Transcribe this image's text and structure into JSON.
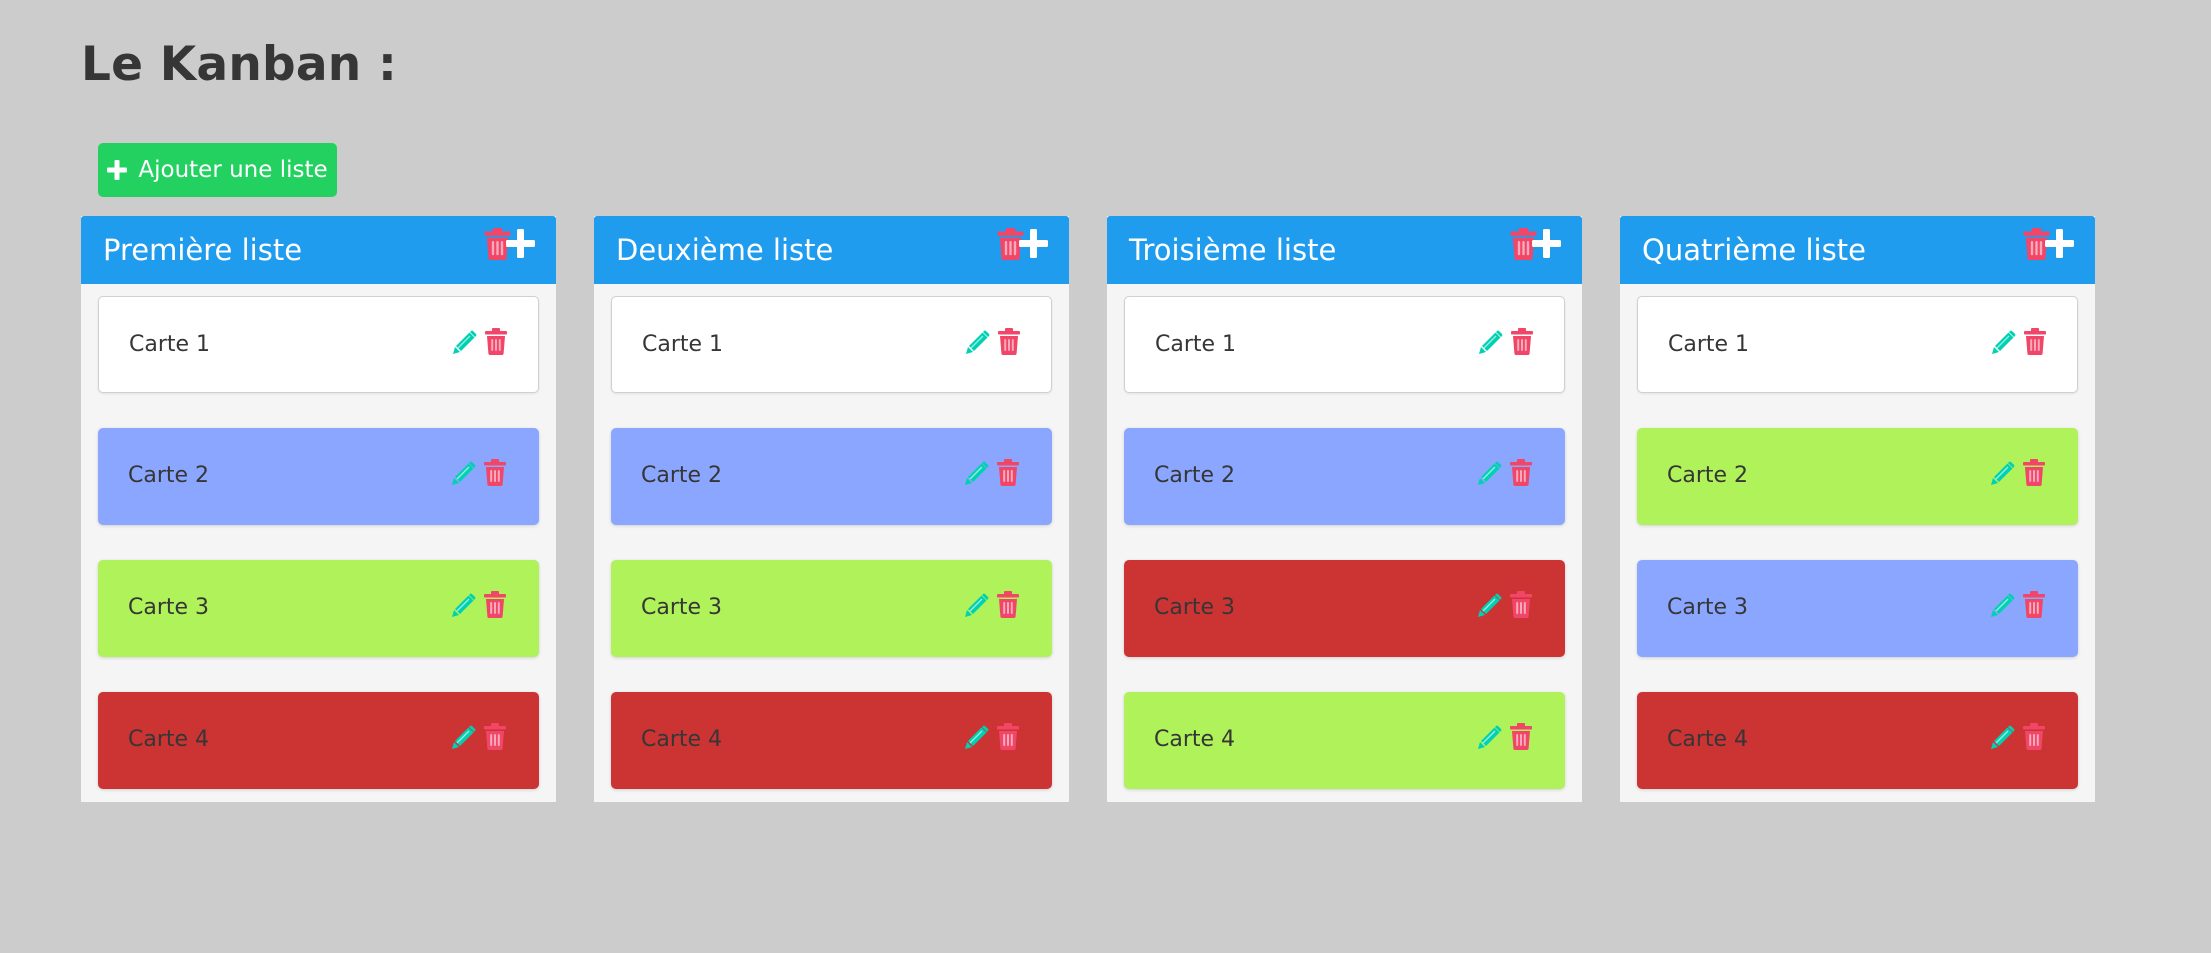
{
  "page": {
    "title": "Le Kanban :"
  },
  "toolbar": {
    "add_list_label": "Ajouter une liste"
  },
  "colors": {
    "background": "#cccccc",
    "list_header": "#209cee",
    "list_body": "#f5f5f5",
    "add_button": "#23d160",
    "edit_icon": "#00d1b2",
    "delete_icon": "#f14668",
    "card_white": "#ffffff",
    "card_blue": "#8aa6ff",
    "card_green": "#aff25a",
    "card_red": "#cc3333"
  },
  "icons": {
    "list_delete": "trash-icon",
    "list_add_card": "plus-icon",
    "card_edit": "pencil-icon",
    "card_delete": "trash-icon",
    "add_list": "plus-icon"
  },
  "lists": [
    {
      "title": "Première liste",
      "cards": [
        {
          "label": "Carte 1",
          "color": "#ffffff"
        },
        {
          "label": "Carte 2",
          "color": "#8aa6ff"
        },
        {
          "label": "Carte 3",
          "color": "#aff25a"
        },
        {
          "label": "Carte 4",
          "color": "#cc3333"
        }
      ]
    },
    {
      "title": "Deuxième liste",
      "cards": [
        {
          "label": "Carte 1",
          "color": "#ffffff"
        },
        {
          "label": "Carte 2",
          "color": "#8aa6ff"
        },
        {
          "label": "Carte 3",
          "color": "#aff25a"
        },
        {
          "label": "Carte 4",
          "color": "#cc3333"
        }
      ]
    },
    {
      "title": "Troisième liste",
      "cards": [
        {
          "label": "Carte 1",
          "color": "#ffffff"
        },
        {
          "label": "Carte 2",
          "color": "#8aa6ff"
        },
        {
          "label": "Carte 3",
          "color": "#cc3333"
        },
        {
          "label": "Carte 4",
          "color": "#aff25a"
        }
      ]
    },
    {
      "title": "Quatrième liste",
      "cards": [
        {
          "label": "Carte 1",
          "color": "#ffffff"
        },
        {
          "label": "Carte 2",
          "color": "#aff25a"
        },
        {
          "label": "Carte 3",
          "color": "#8aa6ff"
        },
        {
          "label": "Carte 4",
          "color": "#cc3333"
        }
      ]
    }
  ]
}
